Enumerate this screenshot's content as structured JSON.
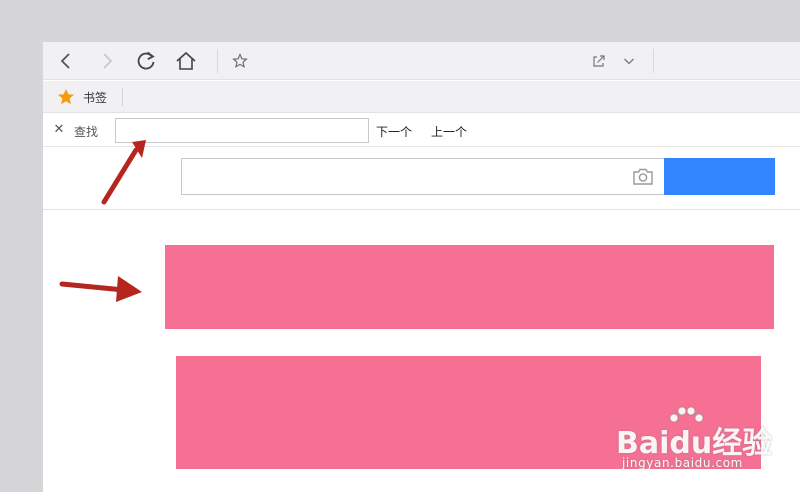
{
  "bookmarks_bar": {
    "label": "书签",
    "star_color": "#f59b0c"
  },
  "find_bar": {
    "close_glyph": "✕",
    "label": "查找",
    "input_value": "",
    "next_label": "下一个",
    "prev_label": "上一个"
  },
  "toolbar": {
    "icons": [
      "back-icon",
      "forward-icon",
      "reload-icon",
      "home-icon",
      "bookmark-star-icon",
      "share-icon",
      "chevron-down-icon"
    ]
  },
  "search": {
    "button_color": "#3385ff",
    "icon": "camera-icon"
  },
  "annotations": {
    "arrow_color": "#b5261f",
    "redaction_color": "#f67093"
  },
  "watermark": {
    "brand": "Baidu经验",
    "url": "jingyan.baidu.com"
  }
}
